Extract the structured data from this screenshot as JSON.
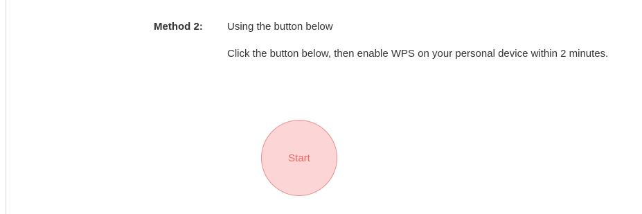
{
  "method": {
    "label": "Method 2:",
    "title": "Using the button below",
    "description": "Click the button below, then enable WPS on your personal device within 2 minutes."
  },
  "start_button": {
    "label": "Start"
  },
  "colors": {
    "button_fill": "#fcd6d6",
    "button_border": "#f08a8a",
    "button_text": "#f0645f"
  }
}
